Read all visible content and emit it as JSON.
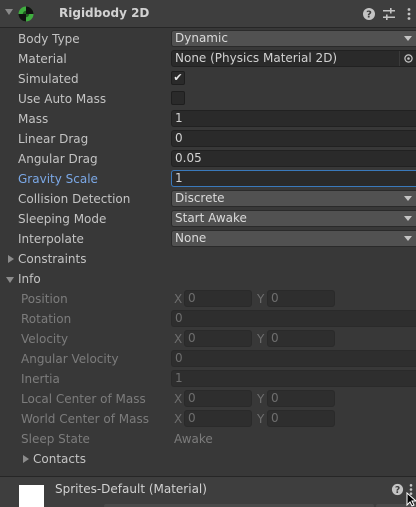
{
  "component": {
    "title": "Rigidbody 2D"
  },
  "properties": {
    "body_type": {
      "label": "Body Type",
      "value": "Dynamic"
    },
    "material": {
      "label": "Material",
      "value": "None (Physics Material 2D)"
    },
    "simulated": {
      "label": "Simulated",
      "checked": true,
      "mark": "✔"
    },
    "use_auto_mass": {
      "label": "Use Auto Mass",
      "checked": false
    },
    "mass": {
      "label": "Mass",
      "value": "1"
    },
    "linear_drag": {
      "label": "Linear Drag",
      "value": "0"
    },
    "angular_drag": {
      "label": "Angular Drag",
      "value": "0.05"
    },
    "gravity_scale": {
      "label": "Gravity Scale",
      "value": "1"
    },
    "collision_detection": {
      "label": "Collision Detection",
      "value": "Discrete"
    },
    "sleeping_mode": {
      "label": "Sleeping Mode",
      "value": "Start Awake"
    },
    "interpolate": {
      "label": "Interpolate",
      "value": "None"
    },
    "constraints": {
      "label": "Constraints"
    }
  },
  "info": {
    "label": "Info",
    "position": {
      "label": "Position",
      "x_label": "X",
      "x": "0",
      "y_label": "Y",
      "y": "0"
    },
    "rotation": {
      "label": "Rotation",
      "value": "0"
    },
    "velocity": {
      "label": "Velocity",
      "x_label": "X",
      "x": "0",
      "y_label": "Y",
      "y": "0"
    },
    "angular_velocity": {
      "label": "Angular Velocity",
      "value": "0"
    },
    "inertia": {
      "label": "Inertia",
      "value": "1"
    },
    "local_center_of_mass": {
      "label": "Local Center of Mass",
      "x_label": "X",
      "x": "0",
      "y_label": "Y",
      "y": "0"
    },
    "world_center_of_mass": {
      "label": "World Center of Mass",
      "x_label": "X",
      "x": "0",
      "y_label": "Y",
      "y": "0"
    },
    "sleep_state": {
      "label": "Sleep State",
      "value": "Awake"
    },
    "contacts": {
      "label": "Contacts"
    }
  },
  "material_section": {
    "title": "Sprites-Default (Material)"
  },
  "colors": {
    "panel_bg": "#383838",
    "field_bg": "#2a2a2a",
    "dropdown_bg": "#515151",
    "focus_accent": "#3a79bb",
    "highlight_label": "#7ba8e6",
    "icon_green": "#3fae3f"
  },
  "icons": {
    "component": "rigidbody2d-icon",
    "help": "help-icon",
    "presets": "presets-icon",
    "more": "kebab-menu-icon",
    "object_picker": "object-picker-icon"
  }
}
